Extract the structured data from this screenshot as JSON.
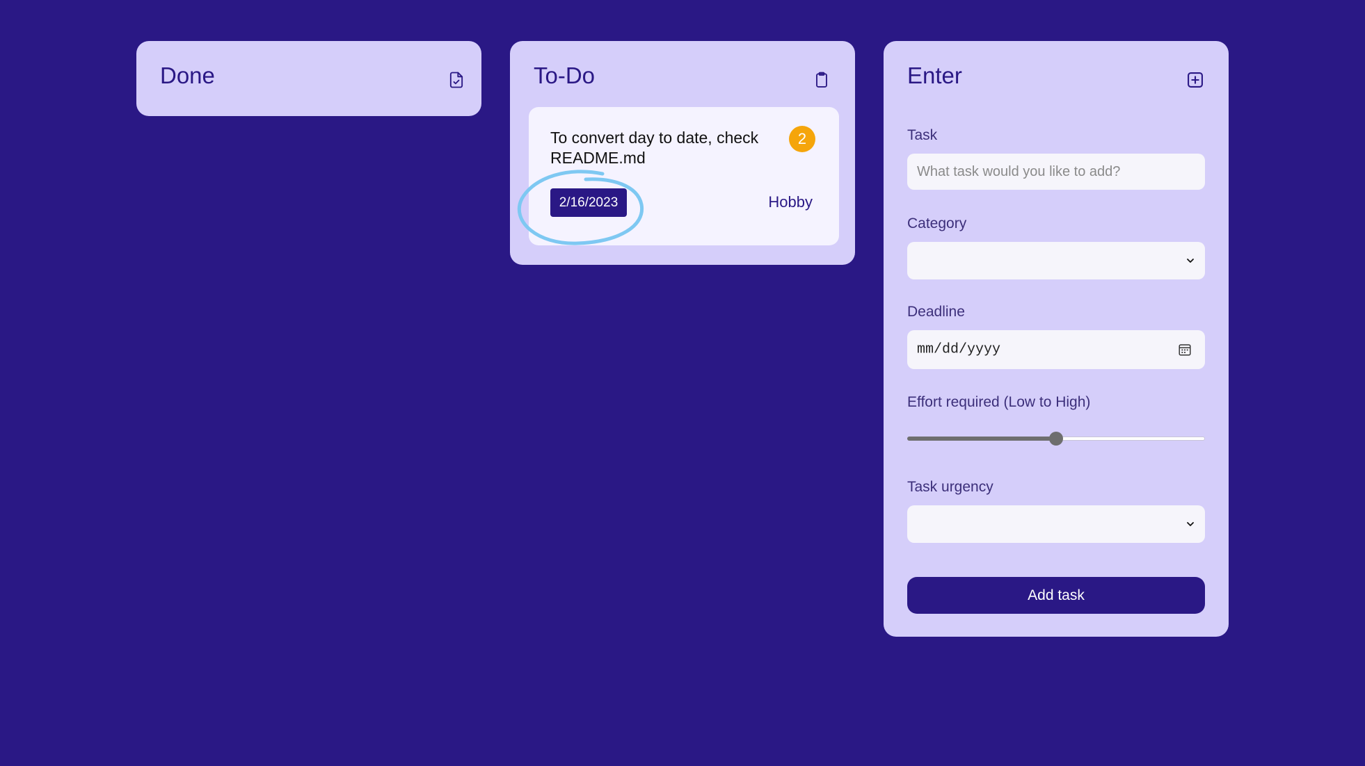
{
  "done": {
    "title": "Done",
    "icon": "file-check-icon"
  },
  "todo": {
    "title": "To-Do",
    "icon": "clipboard-icon",
    "tasks": [
      {
        "text": "To convert day to date, check README.md",
        "effort": "2",
        "date": "2/16/2023",
        "category": "Hobby"
      }
    ]
  },
  "enter": {
    "title": "Enter",
    "icon": "plus-square-icon",
    "task_label": "Task",
    "task_placeholder": "What task would you like to add?",
    "category_label": "Category",
    "category_value": "",
    "deadline_label": "Deadline",
    "deadline_placeholder": "mm/dd/yyyy",
    "effort_label": "Effort required (Low to High)",
    "effort_value": 0.5,
    "urgency_label": "Task urgency",
    "urgency_value": "",
    "submit_label": "Add task"
  },
  "colors": {
    "background": "#2a1885",
    "panel": "#d5cefa",
    "card": "#f5f3ff",
    "accent": "#2a1885",
    "badge": "#f5a50b",
    "annotation": "#7ec8f2"
  }
}
